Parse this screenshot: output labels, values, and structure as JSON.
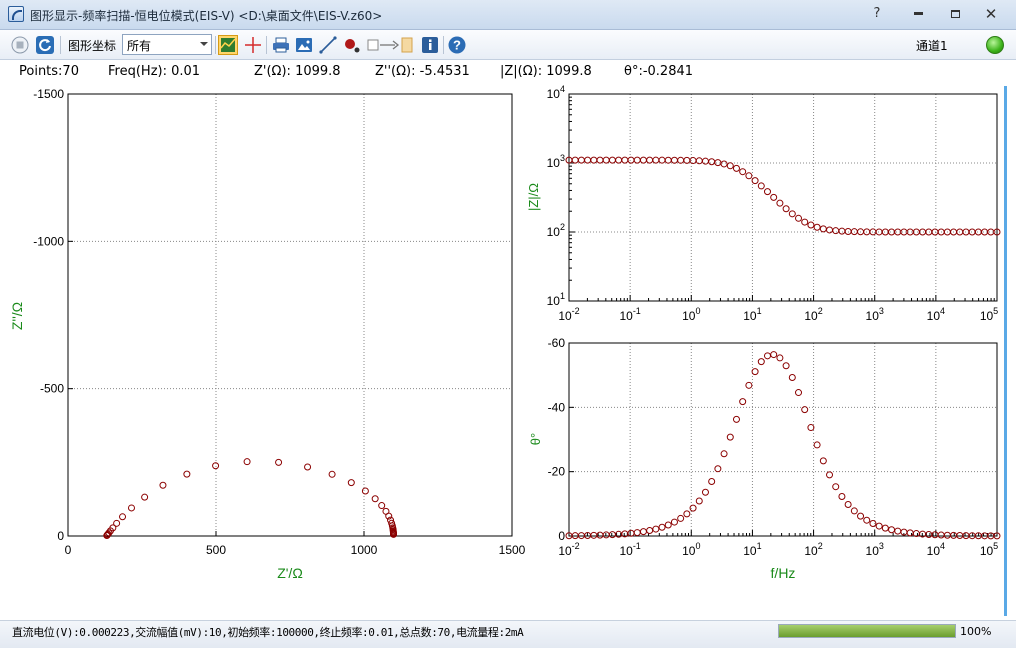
{
  "window": {
    "title": "图形显示-频率扫描-恒电位模式(EIS-V) <D:\\桌面文件\\EIS-V.z60>",
    "help_glyph": "?",
    "minimize_glyph": "▬",
    "maximize_glyph": "▭",
    "close_glyph": "✕"
  },
  "toolbar": {
    "coord_label": "图形坐标",
    "coord_select_value": "所有",
    "channel_label": "通道1",
    "arrow_glyph": "□→"
  },
  "readout": {
    "points": "Points:70",
    "freq": "Freq(Hz): 0.01",
    "z_real": "Z'(Ω): 1099.8",
    "z_imag": "Z''(Ω): -5.4531",
    "z_mod": "|Z|(Ω): 1099.8",
    "theta": "θ°:-0.2841"
  },
  "colors": {
    "axis_label": "#1a8a1a",
    "marker": "#8b0000",
    "grid": "#888888",
    "progress": "#6a9e2e"
  },
  "status": {
    "text": "直流电位(V):0.000223,交流幅值(mV):10,初始频率:100000,终止频率:0.01,总点数:70,电流量程:2mA",
    "progress_value": 1.0,
    "progress_text": "100%"
  },
  "chart_data": [
    {
      "type": "scatter",
      "name_plot": "nyquist",
      "xlabel": "Z'/Ω",
      "ylabel": "Z''/Ω",
      "xlim": [
        0,
        1500
      ],
      "ylim": [
        0,
        -1500
      ],
      "xticks": [
        "0",
        "500",
        "1000",
        "1500"
      ],
      "yticks": [
        "-1500",
        "-1000",
        "-500",
        "0"
      ],
      "grid": true,
      "points": [
        [
          1099.8,
          -5.5
        ],
        [
          1099.7,
          -6.9
        ],
        [
          1099.6,
          -8.7
        ],
        [
          1099.5,
          -10.9
        ],
        [
          1099.2,
          -13.7
        ],
        [
          1098.8,
          -17.3
        ],
        [
          1098.3,
          -21.7
        ],
        [
          1097.3,
          -27.4
        ],
        [
          1095.8,
          -34.3
        ],
        [
          1093.4,
          -43.1
        ],
        [
          1089.6,
          -54.0
        ],
        [
          1083.6,
          -67.4
        ],
        [
          1074.2,
          -83.7
        ],
        [
          1059.8,
          -103.3
        ],
        [
          1037.7,
          -126.3
        ],
        [
          1004.7,
          -152.6
        ],
        [
          957.1,
          -181.1
        ],
        [
          892.2,
          -209.4
        ],
        [
          809.3,
          -234.1
        ],
        [
          711.4,
          -249.9
        ],
        [
          605.0,
          -252.2
        ],
        [
          498.6,
          -238.5
        ],
        [
          401.6,
          -210.1
        ],
        [
          320.8,
          -172.2
        ],
        [
          258.9,
          -131.8
        ],
        [
          214.5,
          -95.2
        ],
        [
          184.2,
          -65.2
        ],
        [
          164.3,
          -43.0
        ],
        [
          151.5,
          -27.6
        ],
        [
          143.4,
          -17.3
        ],
        [
          138.3,
          -10.8
        ],
        [
          135.1,
          -6.6
        ],
        [
          133.1,
          -4.0
        ],
        [
          131.9,
          -2.4
        ],
        [
          131.2,
          -1.5
        ]
      ]
    },
    {
      "type": "scatter",
      "name_plot": "bode-modulus",
      "xlabel": "",
      "ylabel": "|Z|/Ω",
      "xscale": "log",
      "yscale": "log",
      "xlim": [
        0.01,
        100000
      ],
      "ylim": [
        10,
        10000
      ],
      "xticks": [
        "10-2",
        "10-1",
        "100",
        "101",
        "102",
        "103",
        "104",
        "105"
      ],
      "yticks": [
        "101",
        "102",
        "103",
        "104"
      ],
      "grid": true
    },
    {
      "type": "scatter",
      "name_plot": "bode-phase",
      "xlabel": "f/Hz",
      "ylabel": "θ°",
      "xscale": "log",
      "xlim": [
        0.01,
        100000
      ],
      "ylim": [
        0,
        -60
      ],
      "xticks": [
        "10-2",
        "10-1",
        "100",
        "101",
        "102",
        "103",
        "104",
        "105"
      ],
      "yticks": [
        "-60",
        "-40",
        "-20",
        "0"
      ],
      "grid": true
    }
  ]
}
